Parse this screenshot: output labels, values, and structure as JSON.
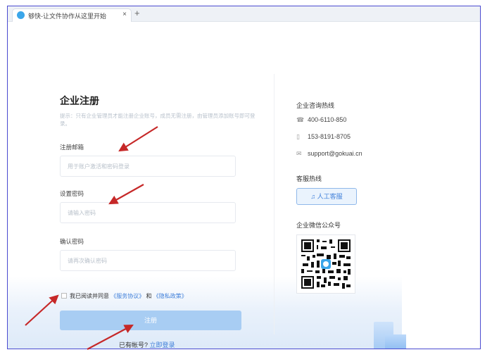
{
  "browser": {
    "tab_title": "够快-让文件协作从这里开始",
    "tab_close": "×",
    "new_tab": "+"
  },
  "form": {
    "title": "企业注册",
    "hint": "提示：只有企业管理员才能注册企业账号，成员无需注册，由管理员添加账号即可登录。",
    "email_label": "注册邮箱",
    "email_placeholder": "用于账户激活和密码登录",
    "password_label": "设置密码",
    "password_placeholder": "请输入密码",
    "confirm_label": "确认密码",
    "confirm_placeholder": "请再次确认密码",
    "agree_text": "我已阅读并同意",
    "terms_link": "《服务协议》",
    "and_text": "和",
    "privacy_link": "《隐私政策》",
    "register_button": "注册",
    "have_account": "已有帐号?",
    "login_link": "立即登录"
  },
  "side": {
    "hotline_title": "企业咨询热线",
    "phone1": "400-6110-850",
    "phone2": "153-8191-8705",
    "email": "support@gokuai.cn",
    "service_title": "客服热线",
    "service_button": "人工客服",
    "wechat_title": "企业微信公众号"
  },
  "colors": {
    "accent": "#3f7fd9",
    "button_disabled": "#a8cdf3",
    "annotation_arrow": "#c62828"
  },
  "icons": [
    "phone-icon",
    "mobile-icon",
    "mail-icon",
    "headset-icon",
    "qr-code"
  ]
}
